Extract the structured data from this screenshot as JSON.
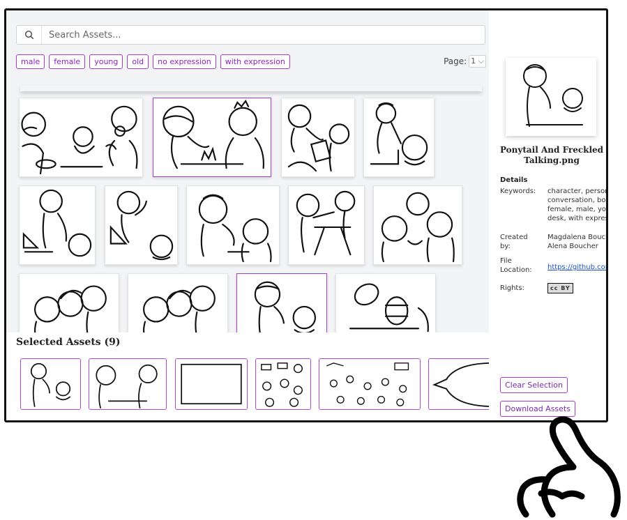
{
  "search": {
    "placeholder": "Search Assets..."
  },
  "tags": [
    "male",
    "female",
    "young",
    "old",
    "no expression",
    "with expression"
  ],
  "pagination": {
    "label": "Page:",
    "value": "1"
  },
  "selected": {
    "title": "Selected Assets (9)"
  },
  "preview": {
    "title": "Ponytail And Freckled Talking.png",
    "details_heading": "Details",
    "keywords_label": "Keywords:",
    "keywords_lines": [
      "character, person,",
      "conversation, boy,",
      "female, male, you",
      "desk, with expres"
    ],
    "created_label_1": "Created",
    "created_label_2": "by:",
    "created_lines": [
      "Magdalena Bouch",
      "Alena Boucher"
    ],
    "file_label_1": "File",
    "file_label_2": "Location:",
    "file_value": "https://github.com",
    "rights_label": "Rights:",
    "rights_badge": "cc BY"
  },
  "buttons": {
    "clear": "Clear Selection",
    "download": "Download Assets"
  },
  "colors": {
    "accent": "#a63bd0",
    "link": "#1a4fd8",
    "panel_bg": "#f3f4f6"
  }
}
